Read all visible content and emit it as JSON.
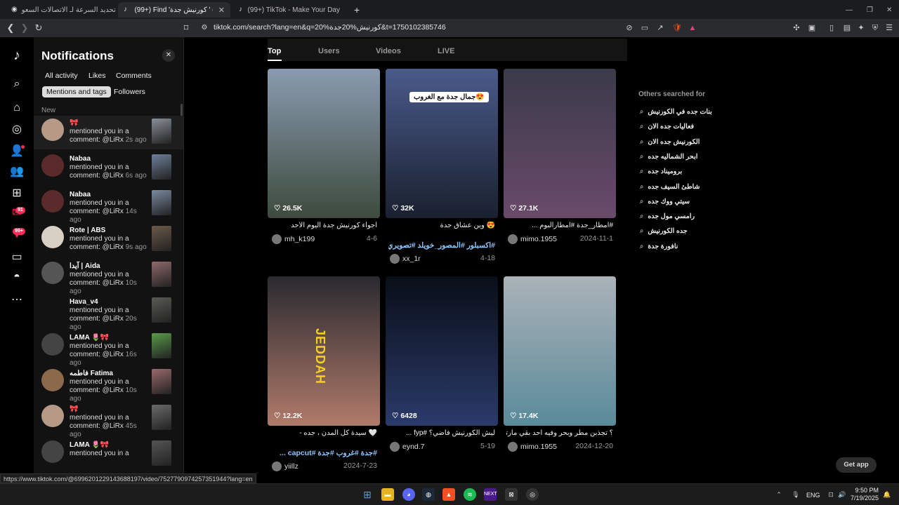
{
  "browser": {
    "tabs": [
      {
        "label": "تخطي تحديد السرعة لـ الاتصالات السعو..."
      },
      {
        "label": "(99+) Find 'كورنيش جدة ' on TikTok",
        "active": true
      },
      {
        "label": "(99+) TikTok - Make Your Day"
      }
    ],
    "url": "tiktok.com/search?lang=en&q=كورنيش%20جدة%20&t=1750102385746"
  },
  "notifications": {
    "title": "Notifications",
    "filters_row1": [
      "All activity",
      "Likes",
      "Comments"
    ],
    "filters_row2": [
      "Mentions and tags",
      "Followers"
    ],
    "section": "New",
    "items": [
      {
        "name": "🎀",
        "text": "mentioned you in a comment: @LiRx",
        "time": "2s ago",
        "avatar": "#b79a86",
        "thumb": "#8a8f98"
      },
      {
        "name": "Nabaa",
        "text": "mentioned you in a comment: @LiRx",
        "time": "6s ago",
        "avatar": "#5b2b2b",
        "thumb": "#6e7f9a"
      },
      {
        "name": "Nabaa",
        "text": "mentioned you in a comment: @LiRx",
        "time": "14s ago",
        "avatar": "#5b2b2b",
        "thumb": "#7a8aa0"
      },
      {
        "name": "Rote | ABS",
        "text": "mentioned you in a comment: @LiRx",
        "time": "9s ago",
        "avatar": "#d8d0c4",
        "thumb": "#6b5a4a"
      },
      {
        "name": "آيدا | Aida",
        "text": "mentioned you in a comment: @LiRx",
        "time": "10s ago",
        "avatar": "#555",
        "thumb": "#8f6a6a"
      },
      {
        "name": "Hava_v4",
        "text": "mentioned you in a comment: @LiRx",
        "time": "20s ago",
        "avatar": "#121212",
        "thumb": "#5a5a55"
      },
      {
        "name": "LAMA 🌷🎀",
        "text": "mentioned you in a comment: @LiRx",
        "time": "16s ago",
        "avatar": "#444",
        "thumb": "#5a9a4a"
      },
      {
        "name": "فاطمه Fatima",
        "text": "mentioned you in a comment: @LiRx",
        "time": "10s ago",
        "avatar": "#8a6a4a",
        "thumb": "#9a6a6a"
      },
      {
        "name": "🎀",
        "text": "mentioned you in a comment: @LiRx",
        "time": "45s ago",
        "avatar": "#b79a86",
        "thumb": "#6a6a6a"
      },
      {
        "name": "LAMA 🌷🎀",
        "text": "mentioned you in a",
        "time": "",
        "avatar": "#444",
        "thumb": "#555"
      }
    ]
  },
  "search": {
    "tabs": [
      "Top",
      "Users",
      "Videos",
      "LIVE"
    ],
    "videos": [
      {
        "likes": "26.5K",
        "caption": "أجواء كورنيش جدة اليوم الأحد",
        "user": "mh_k199",
        "date": "4-6",
        "c1": "#8a9bb0",
        "c2": "#3d4a3d"
      },
      {
        "likes": "32K",
        "caption": "😍 وين عشاق جدة",
        "caption2": "#اكسبلور #المصور_خويلد #تصويري",
        "user": "xx_1r",
        "date": "4-18",
        "c1": "#4a5a8a",
        "c2": "#1a2030",
        "overlay": "جمال جدة مع الغروب😍"
      },
      {
        "likes": "27.1K",
        "caption": "#امطار_جدة #امطارالبوم ...",
        "user": "mimo.1955",
        "date": "2024-11-1",
        "c1": "#3a3a4a",
        "c2": "#6a4a6a"
      },
      {
        "likes": "12.2K",
        "caption": "🤍 سيدة كل المدن ، جده -",
        "caption2": "#جدة #غروب #جدة #capcut ...",
        "user": "yiillz",
        "date": "2024-7-23",
        "c1": "#2a2a30",
        "c2": "#b07a6a",
        "overlay": "JEDDAH"
      },
      {
        "likes": "6428",
        "caption": "ليش الكورنيش فاضي؟ #fyp ...",
        "user": "eynd.7",
        "date": "5-19",
        "c1": "#0a0e18",
        "c2": "#2a3a6a"
      },
      {
        "likes": "17.4K",
        "caption": "؟ تجذبن مطر وبحر وفيه احد بقي مارتاح",
        "user": "mimo.1955",
        "date": "2024-12-20",
        "c1": "#aab2b8",
        "c2": "#5a8a9a"
      }
    ],
    "others_title": "Others searched for",
    "others": [
      "بنات جده في الكورنيش",
      "فعاليات جده الان",
      "الكورنيش جده الان",
      "ابحر الشماليه جده",
      "بروميناد جده",
      "شاطئ السيف جده",
      "سيتي ووك جده",
      "رامسي مول جده",
      "جده الكورنيش",
      "نافورة جدة"
    ],
    "get_app": "Get app"
  },
  "status_link": "https://www.tiktok.com/@6996201229143688197/video/7527790974257351944?lang=en",
  "rail": {
    "badge1": "91",
    "badge2": "99+"
  },
  "taskbar": {
    "lang": "ENG",
    "time": "9:50 PM",
    "date": "7/19/2025"
  },
  "colors": {
    "accent": "#fe2c55",
    "bg": "#000000",
    "panel": "#121212"
  }
}
